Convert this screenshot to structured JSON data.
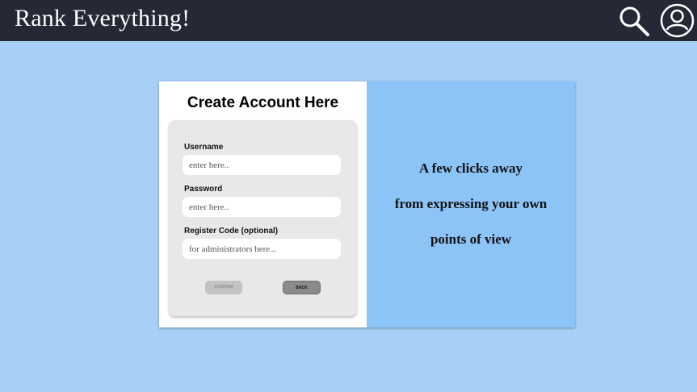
{
  "header": {
    "app_title": "Rank Everything!",
    "search_icon": "search-icon",
    "account_icon": "user-account-icon"
  },
  "form": {
    "title": "Create Account Here",
    "username": {
      "label": "Username",
      "placeholder": "enter here.."
    },
    "password": {
      "label": "Password",
      "placeholder": "enter here.."
    },
    "register_code": {
      "label": "Register Code (optional)",
      "placeholder": "for administrators here..."
    },
    "confirm_label": "CONFIRM",
    "back_label": "BACK"
  },
  "promo": {
    "lines": [
      "A few clicks away",
      "from expressing your own",
      "points of view"
    ]
  },
  "colors": {
    "background": "#a6d0f5",
    "header": "#262836",
    "promo_panel": "#8cc4f7",
    "form_box": "#e8e8e8"
  }
}
